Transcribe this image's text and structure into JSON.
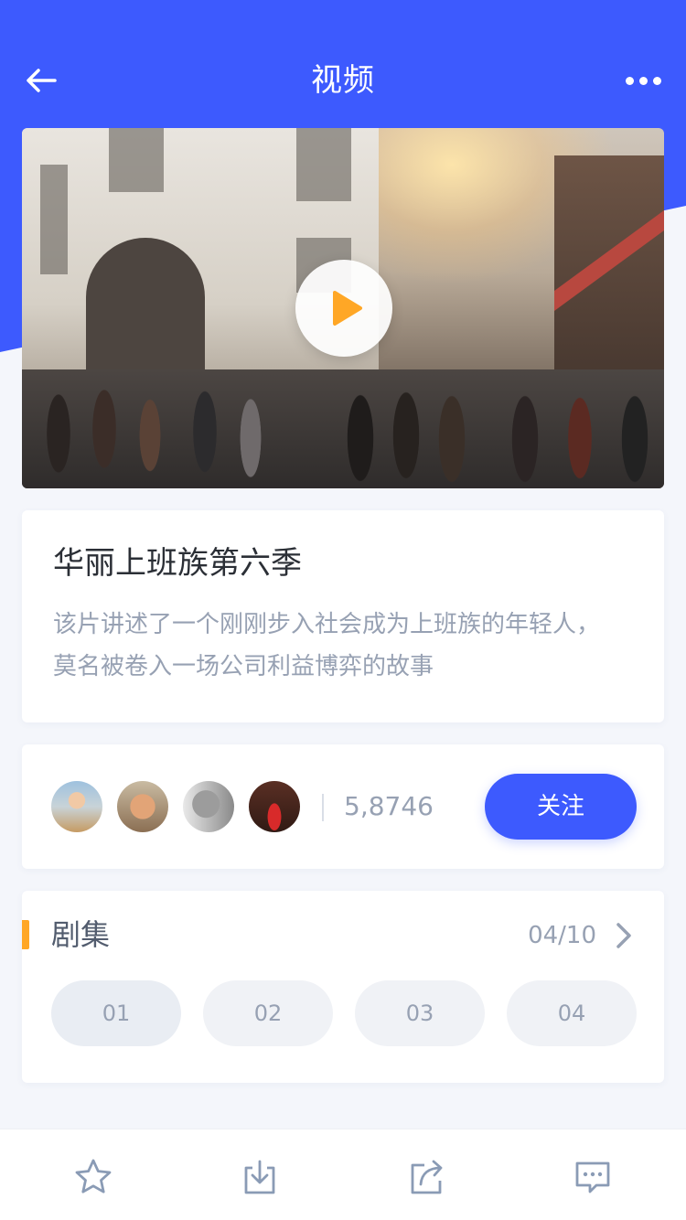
{
  "colors": {
    "primary": "#3d5afe",
    "accent": "#ffa726",
    "text_dark": "#2b2f36",
    "text_muted": "#97a1b3",
    "page_bg": "#f4f6fb"
  },
  "navbar": {
    "title": "视频",
    "back_icon": "arrow-left-icon",
    "more_icon": "more-dots-icon"
  },
  "video": {
    "play_icon": "play-icon"
  },
  "info": {
    "title": "华丽上班族第六季",
    "description": "该片讲述了一个刚刚步入社会成为上班族的年轻人，莫名被卷入一场公司利益博弈的故事"
  },
  "followers": {
    "count": "5,8746",
    "follow_label": "关注"
  },
  "episodes": {
    "title": "剧集",
    "progress": "04/10",
    "next_icon": "chevron-right-icon",
    "items": [
      {
        "label": "01"
      },
      {
        "label": "02"
      },
      {
        "label": "03"
      },
      {
        "label": "04"
      }
    ]
  },
  "tabbar": {
    "icons": [
      "star-icon",
      "download-icon",
      "share-icon",
      "comment-icon"
    ]
  }
}
